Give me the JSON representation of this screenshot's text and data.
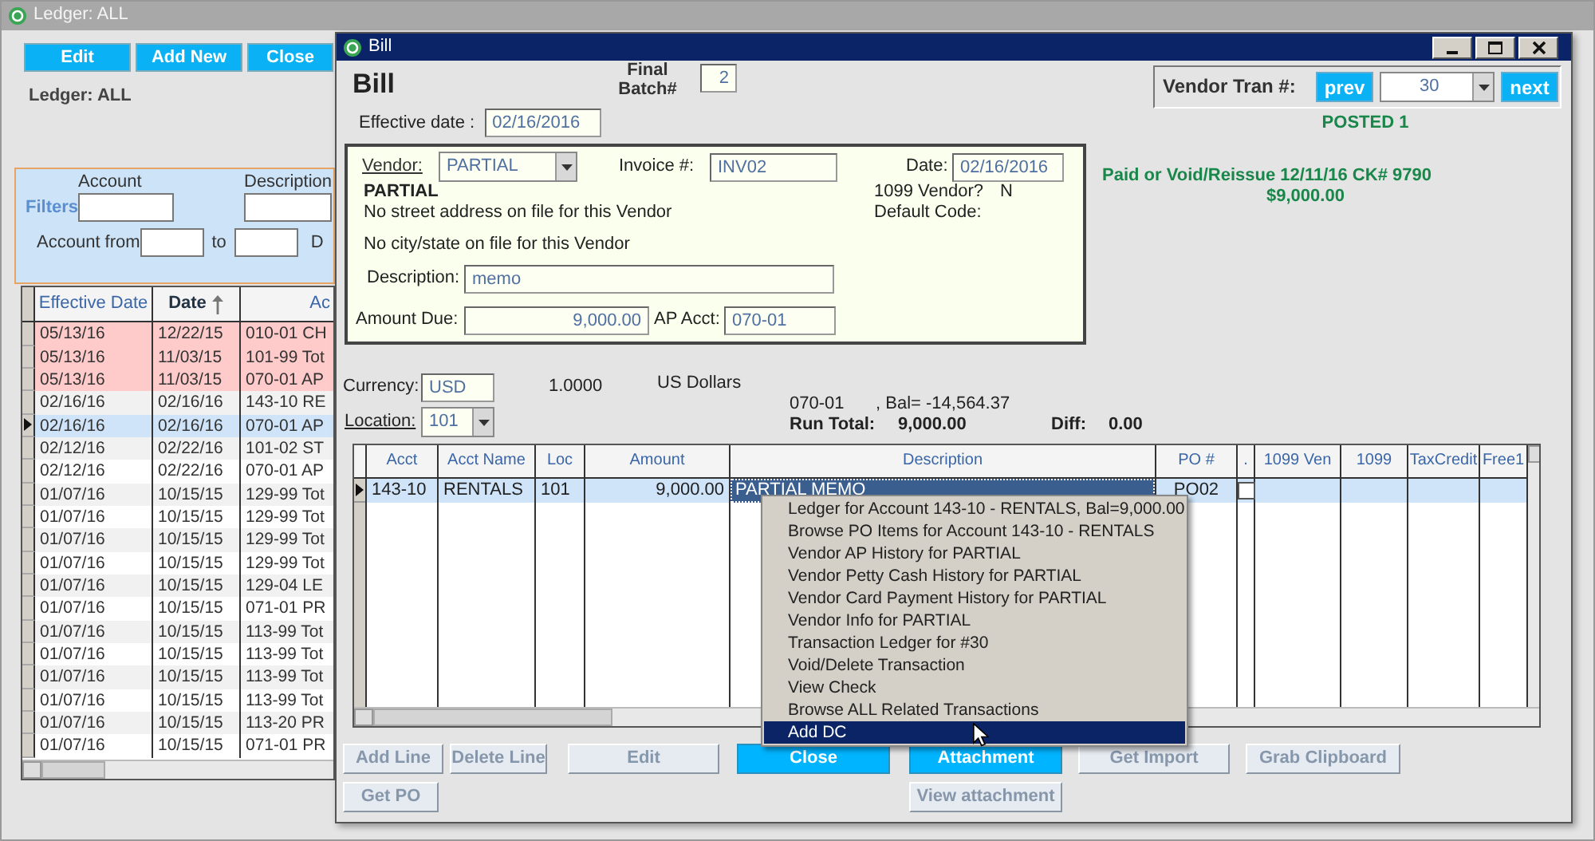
{
  "ledger_window": {
    "title": "Ledger: ALL",
    "buttons": [
      "Edit",
      "Add New",
      "Close"
    ],
    "heading": "Ledger: ALL",
    "filters": {
      "label": "Filters",
      "account_label": "Account",
      "description_label": "Description",
      "account_from_label": "Account from",
      "to_label": "to",
      "column_3_label": "D"
    },
    "table": {
      "columns": [
        {
          "label": "Effective Date",
          "sorted": false
        },
        {
          "label": "Date",
          "sorted": true
        },
        {
          "label": "Ac",
          "sorted": false
        }
      ],
      "rows": [
        {
          "cells": [
            "05/13/16",
            "12/22/15",
            "010-01 CH"
          ],
          "flagged": true,
          "selected": false
        },
        {
          "cells": [
            "05/13/16",
            "11/03/15",
            "101-99 Tot"
          ],
          "flagged": true,
          "selected": false
        },
        {
          "cells": [
            "05/13/16",
            "11/03/15",
            "070-01 AP"
          ],
          "flagged": true,
          "selected": false
        },
        {
          "cells": [
            "02/16/16",
            "02/16/16",
            "143-10 RE"
          ],
          "flagged": false,
          "selected": false
        },
        {
          "cells": [
            "02/16/16",
            "02/16/16",
            "070-01 AP"
          ],
          "flagged": false,
          "selected": true
        },
        {
          "cells": [
            "02/12/16",
            "02/22/16",
            "101-02 ST"
          ],
          "flagged": false,
          "selected": false
        },
        {
          "cells": [
            "02/12/16",
            "02/22/16",
            "070-01 AP"
          ],
          "flagged": false,
          "selected": false
        },
        {
          "cells": [
            "01/07/16",
            "10/15/15",
            "129-99 Tot"
          ],
          "flagged": false,
          "selected": false
        },
        {
          "cells": [
            "01/07/16",
            "10/15/15",
            "129-99 Tot"
          ],
          "flagged": false,
          "selected": false
        },
        {
          "cells": [
            "01/07/16",
            "10/15/15",
            "129-99 Tot"
          ],
          "flagged": false,
          "selected": false
        },
        {
          "cells": [
            "01/07/16",
            "10/15/15",
            "129-99 Tot"
          ],
          "flagged": false,
          "selected": false
        },
        {
          "cells": [
            "01/07/16",
            "10/15/15",
            "129-04 LE"
          ],
          "flagged": false,
          "selected": false
        },
        {
          "cells": [
            "01/07/16",
            "10/15/15",
            "071-01 PR"
          ],
          "flagged": false,
          "selected": false
        },
        {
          "cells": [
            "01/07/16",
            "10/15/15",
            "113-99 Tot"
          ],
          "flagged": false,
          "selected": false
        },
        {
          "cells": [
            "01/07/16",
            "10/15/15",
            "113-99 Tot"
          ],
          "flagged": false,
          "selected": false
        },
        {
          "cells": [
            "01/07/16",
            "10/15/15",
            "113-99 Tot"
          ],
          "flagged": false,
          "selected": false
        },
        {
          "cells": [
            "01/07/16",
            "10/15/15",
            "113-99 Tot"
          ],
          "flagged": false,
          "selected": false
        },
        {
          "cells": [
            "01/07/16",
            "10/15/15",
            "113-20 PR"
          ],
          "flagged": false,
          "selected": false
        },
        {
          "cells": [
            "01/07/16",
            "10/15/15",
            "071-01 PR"
          ],
          "flagged": false,
          "selected": false
        }
      ]
    }
  },
  "bill_window": {
    "title": "Bill",
    "heading": "Bill",
    "final_batch": {
      "label": "Final Batch#",
      "value": "2"
    },
    "effective_date": {
      "label": "Effective date :",
      "value": "02/16/2016"
    },
    "vendor_tran": {
      "label": "Vendor Tran #:",
      "prev": "prev",
      "value": "30",
      "next": "next"
    },
    "status": "POSTED 1",
    "vendor_panel": {
      "vendor_label": "Vendor:",
      "vendor_value": "PARTIAL",
      "invoice_label": "Invoice #:",
      "invoice_value": "INV02",
      "date_label": "Date:",
      "date_value": "02/16/2016",
      "vendor_name": "PARTIAL",
      "address_line": "No street address on file for this Vendor",
      "city_line": "No city/state on file for this Vendor",
      "vendor_1099_label": "1099 Vendor?",
      "vendor_1099_value": "N",
      "default_code_label": "Default Code:",
      "description_label": "Description:",
      "description_value": "memo",
      "amount_due_label": "Amount Due:",
      "amount_due_value": "9,000.00",
      "ap_acct_label": "AP Acct:",
      "ap_acct_value": "070-01"
    },
    "payment_note": [
      "Paid or Void/Reissue 12/11/16 CK# 9790",
      "$9,000.00"
    ],
    "currency": {
      "label": "Currency:",
      "value": "USD",
      "rate": "1.0000",
      "name": "US Dollars"
    },
    "location": {
      "label": "Location:",
      "value": "101"
    },
    "balance": {
      "account": "070-01",
      "text": ",  Bal= -14,564.37"
    },
    "run_total": {
      "label": "Run Total:",
      "value": "9,000.00"
    },
    "diff": {
      "label": "Diff:",
      "value": "0.00"
    },
    "grid": {
      "columns": [
        {
          "label": "Acct",
          "kind": "text"
        },
        {
          "label": "Acct Name",
          "kind": "text"
        },
        {
          "label": "Loc",
          "kind": "text"
        },
        {
          "label": "Amount",
          "kind": "text"
        },
        {
          "label": "Description",
          "kind": "text"
        },
        {
          "label": "PO #",
          "kind": "text"
        },
        {
          "label": ".",
          "kind": "check"
        },
        {
          "label": "1099 Ven",
          "kind": "text"
        },
        {
          "label": "1099",
          "kind": "text"
        },
        {
          "label": "TaxCredit",
          "kind": "text"
        },
        {
          "label": "Free1",
          "kind": "text"
        }
      ],
      "rows": [
        {
          "selected": true,
          "checked": false,
          "cells": [
            {
              "text": "143-10",
              "selected": false
            },
            {
              "text": "RENTALS",
              "selected": false
            },
            {
              "text": "101",
              "selected": false
            },
            {
              "text": "9,000.00",
              "selected": false
            },
            {
              "text": "PARTIAL MEMO",
              "selected": true
            },
            {
              "text": "PO02",
              "selected": false
            }
          ]
        }
      ]
    },
    "context_menu": [
      {
        "label": "Ledger for Account 143-10 - RENTALS,  Bal=9,000.00",
        "selected": false
      },
      {
        "label": "Browse PO Items for Account 143-10 - RENTALS",
        "selected": false
      },
      {
        "label": "Vendor AP History for PARTIAL",
        "selected": false
      },
      {
        "label": "Vendor Petty Cash History for PARTIAL",
        "selected": false
      },
      {
        "label": "Vendor Card Payment History for PARTIAL",
        "selected": false
      },
      {
        "label": "Vendor Info for PARTIAL",
        "selected": false
      },
      {
        "label": "Transaction Ledger for #30",
        "selected": false
      },
      {
        "label": "Void/Delete Transaction",
        "selected": false
      },
      {
        "label": "View Check",
        "selected": false
      },
      {
        "label": "Browse ALL Related Transactions",
        "selected": false
      },
      {
        "label": "Add DC",
        "selected": true
      }
    ],
    "buttons": [
      [
        {
          "label": "Add Line",
          "highlighted": false
        },
        {
          "label": "Delete Line",
          "highlighted": false
        },
        {
          "label": "Edit",
          "highlighted": false
        },
        {
          "label": "Close",
          "highlighted": true
        },
        {
          "label": "Attachment",
          "highlighted": true
        },
        {
          "label": "Get Import",
          "highlighted": false
        },
        {
          "label": "Grab Clipboard",
          "highlighted": false
        }
      ],
      [
        {
          "label": "Get PO",
          "highlighted": false
        },
        {
          "label": "View attachment",
          "highlighted": false
        }
      ]
    ]
  }
}
